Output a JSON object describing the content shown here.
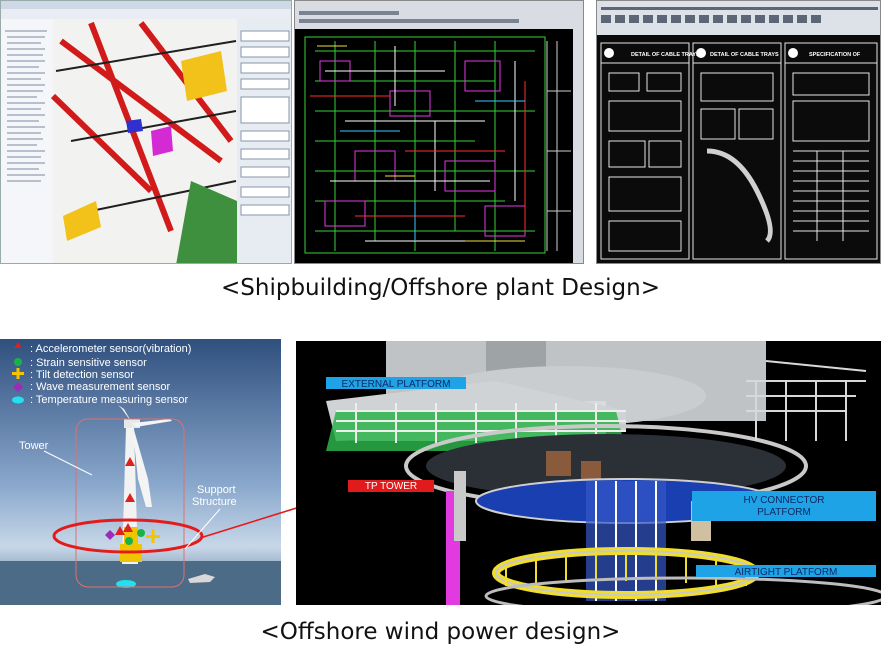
{
  "captions": {
    "top": "<Shipbuilding/Offshore plant Design>",
    "bottom": "<Offshore wind power design>"
  },
  "sensor_legend": [
    {
      "icon": "red-triangle-icon",
      "label": ": Accelerometer sensor(vibration)",
      "color": "#e02020"
    },
    {
      "icon": "green-circle-icon",
      "label": ": Strain sensitive sensor",
      "color": "#19b24a"
    },
    {
      "icon": "yellow-cross-icon",
      "label": ": Tilt detection sensor",
      "color": "#f5c400"
    },
    {
      "icon": "purple-diamond-icon",
      "label": ": Wave measurement sensor",
      "color": "#9b2bb8"
    },
    {
      "icon": "cyan-ellipse-icon",
      "label": ": Temperature measuring sensor",
      "color": "#22e0f0"
    }
  ],
  "turbine_labels": {
    "tower": "Tower",
    "support_line1": "Support",
    "support_line2": "Structure"
  },
  "platform_labels": {
    "external": "EXTERNAL PLATFORM",
    "tp_tower": "TP TOWER",
    "hv_line1": "HV CONNECTOR",
    "hv_line2": "PLATFORM",
    "airtight": "AIRTIGHT PLATFORM"
  },
  "cad_panel_titles": {
    "detail1": "DETAIL OF CABLE TRAYS",
    "detail2": "DETAIL OF CABLE TRAYS",
    "spec": "SPECIFICATION OF"
  },
  "colors": {
    "accent_red": "#e41b1b",
    "label_blue": "#1ea3e6",
    "tp_red": "#e11b1b"
  }
}
